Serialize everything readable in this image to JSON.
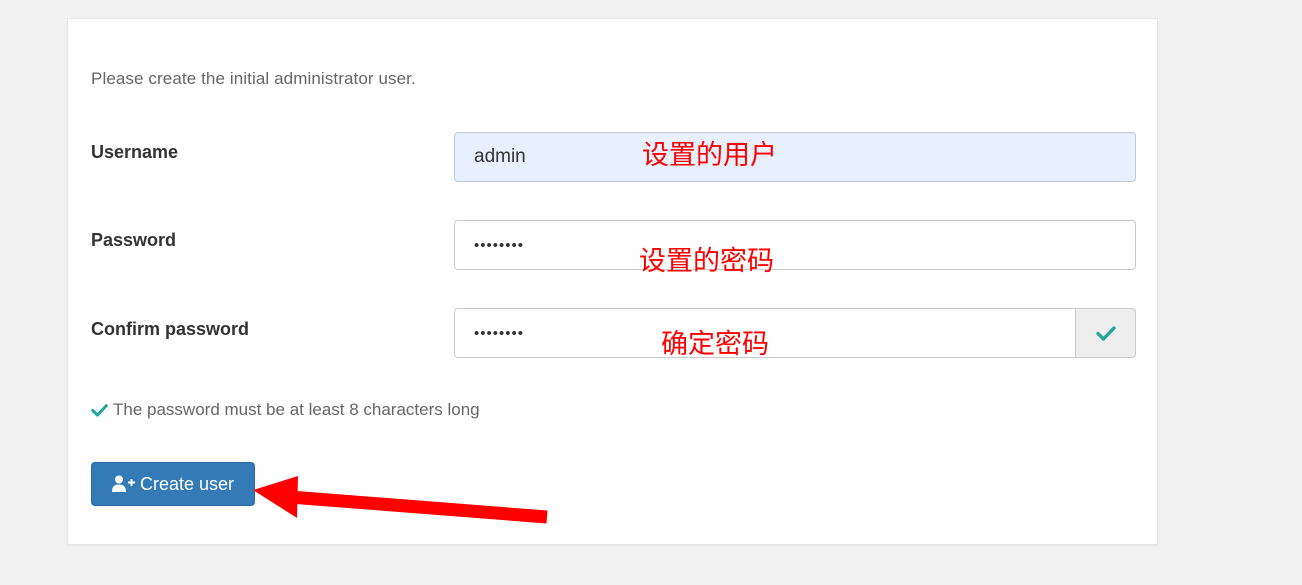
{
  "form": {
    "intro": "Please create the initial administrator user.",
    "username": {
      "label": "Username",
      "value": "admin"
    },
    "password": {
      "label": "Password",
      "value": "••••••••"
    },
    "confirm": {
      "label": "Confirm password",
      "value": "••••••••"
    },
    "hint": "The password must be at least 8 characters long",
    "submit_label": "Create user"
  },
  "annotations": {
    "username_note": "设置的用户",
    "password_note": "设置的密码",
    "confirm_note": "确定密码"
  },
  "icons": {
    "confirm_status": "check-icon",
    "hint_status": "check-icon",
    "button": "user-plus-icon"
  },
  "colors": {
    "accent": "#337ab7",
    "success": "#26a69a",
    "annotation": "#ff0000",
    "autofill": "#e8f0fe"
  }
}
